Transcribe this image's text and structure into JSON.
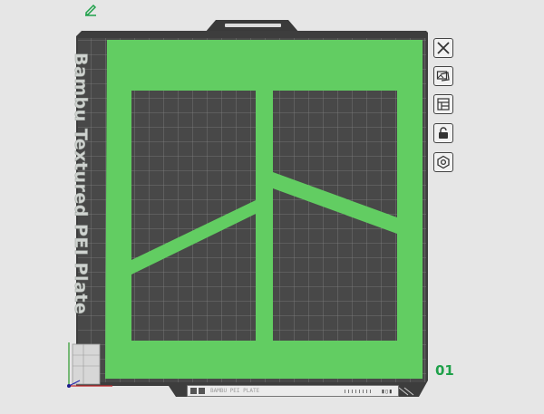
{
  "toolbar": {
    "edit_icon": "pencil-icon",
    "buttons": [
      {
        "name": "close",
        "icon": "close-icon"
      },
      {
        "name": "import-image",
        "icon": "image-icon"
      },
      {
        "name": "arrange",
        "icon": "layout-icon"
      },
      {
        "name": "lock",
        "icon": "lock-icon"
      },
      {
        "name": "settings",
        "icon": "hex-nut-icon"
      }
    ]
  },
  "plate": {
    "name": "Bambu Textured PEI Plate",
    "number": "01",
    "tag_text": "BAMBU PEI PLATE",
    "colors": {
      "bed": "#4a4a4a",
      "frame": "#3d3d3d",
      "grid": "#7b7b7b",
      "model": "#62cd62",
      "plate_number": "#1fa14a"
    }
  }
}
